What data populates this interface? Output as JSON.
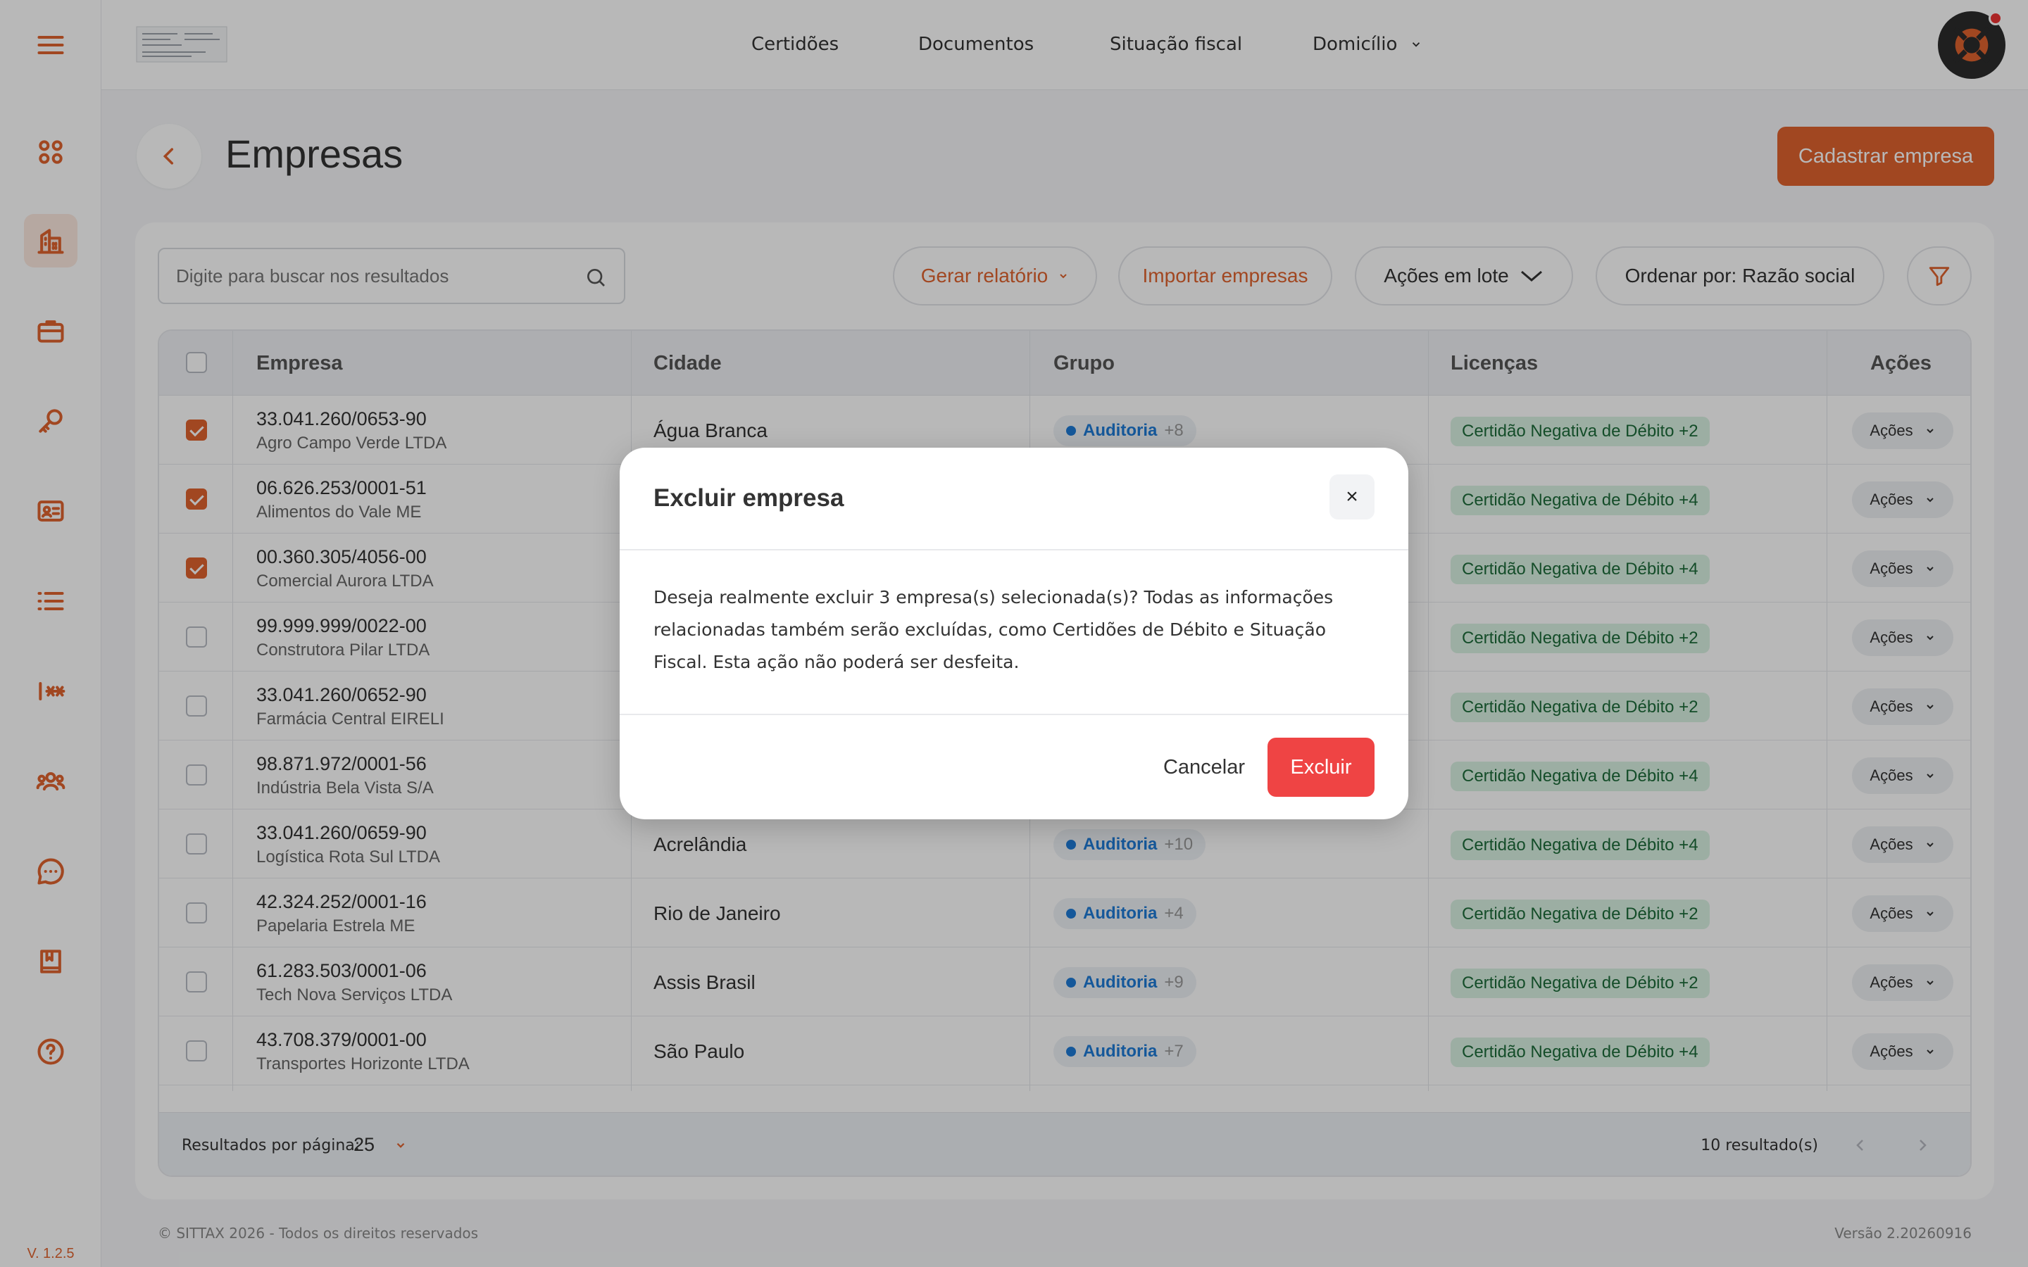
{
  "sidebar": {
    "version": "V. 1.2.5",
    "icons": [
      "menu-icon",
      "dashboard-icon",
      "buildings-icon",
      "briefcase-icon",
      "key-icon",
      "id-card-icon",
      "list-icon",
      "password-icon",
      "users-icon",
      "chat-icon",
      "book-icon",
      "help-icon"
    ]
  },
  "nav": {
    "items": [
      "Certidões",
      "Documentos",
      "Situação fiscal",
      "Domicílio"
    ]
  },
  "page": {
    "title": "Empresas",
    "primary_action": "Cadastrar empresa"
  },
  "toolbar": {
    "search_placeholder": "Digite para buscar nos resultados",
    "report": "Gerar relatório",
    "import": "Importar empresas",
    "bulk": "Ações em lote",
    "sort": "Ordenar por: Razão social"
  },
  "table": {
    "headers": [
      "Empresa",
      "Cidade",
      "Grupo",
      "Licenças",
      "Ações"
    ],
    "rows": [
      {
        "checked": true,
        "cnpj": "33.041.260/0653-90",
        "razao": "Agro Campo Verde LTDA",
        "cidade": "Água Branca",
        "grupo": "Auditoria",
        "grupo_more": "+8",
        "licenca": "Certidão Negativa de Débito +2",
        "acao": "Ações"
      },
      {
        "checked": true,
        "cnpj": "06.626.253/0001-51",
        "razao": "Alimentos do Vale ME",
        "cidade": "",
        "grupo": "",
        "grupo_more": "",
        "licenca": "Certidão Negativa de Débito +4",
        "acao": "Ações"
      },
      {
        "checked": true,
        "cnpj": "00.360.305/4056-00",
        "razao": "Comercial Aurora LTDA",
        "cidade": "",
        "grupo": "",
        "grupo_more": "",
        "licenca": "Certidão Negativa de Débito +4",
        "acao": "Ações"
      },
      {
        "checked": false,
        "cnpj": "99.999.999/0022-00",
        "razao": "Construtora Pilar LTDA",
        "cidade": "",
        "grupo": "",
        "grupo_more": "",
        "licenca": "Certidão Negativa de Débito +2",
        "acao": "Ações"
      },
      {
        "checked": false,
        "cnpj": "33.041.260/0652-90",
        "razao": "Farmácia Central EIRELI",
        "cidade": "",
        "grupo": "",
        "grupo_more": "",
        "licenca": "Certidão Negativa de Débito +2",
        "acao": "Ações"
      },
      {
        "checked": false,
        "cnpj": "98.871.972/0001-56",
        "razao": "Indústria Bela Vista S/A",
        "cidade": "",
        "grupo": "",
        "grupo_more": "",
        "licenca": "Certidão Negativa de Débito +4",
        "acao": "Ações"
      },
      {
        "checked": false,
        "cnpj": "33.041.260/0659-90",
        "razao": "Logística Rota Sul LTDA",
        "cidade": "Acrelândia",
        "grupo": "Auditoria",
        "grupo_more": "+10",
        "licenca": "Certidão Negativa de Débito +4",
        "acao": "Ações"
      },
      {
        "checked": false,
        "cnpj": "42.324.252/0001-16",
        "razao": "Papelaria Estrela ME",
        "cidade": "Rio de Janeiro",
        "grupo": "Auditoria",
        "grupo_more": "+4",
        "licenca": "Certidão Negativa de Débito +2",
        "acao": "Ações"
      },
      {
        "checked": false,
        "cnpj": "61.283.503/0001-06",
        "razao": "Tech Nova Serviços LTDA",
        "cidade": "Assis Brasil",
        "grupo": "Auditoria",
        "grupo_more": "+9",
        "licenca": "Certidão Negativa de Débito +2",
        "acao": "Ações"
      },
      {
        "checked": false,
        "cnpj": "43.708.379/0001-00",
        "razao": "Transportes Horizonte LTDA",
        "cidade": "São Paulo",
        "grupo": "Auditoria",
        "grupo_more": "+7",
        "licenca": "Certidão Negativa de Débito +4",
        "acao": "Ações"
      }
    ],
    "footer": {
      "per_page_label": "Resultados por página:",
      "per_page_value": "25",
      "count": "10 resultado(s)"
    }
  },
  "footer": {
    "copyright": "© SITTAX 2026 - Todos os direitos reservados",
    "version": "Versão 2.20260916"
  },
  "modal": {
    "title": "Excluir empresa",
    "close": "×",
    "body": "Deseja realmente excluir 3 empresa(s) selecionada(s)? Todas as informações relacionadas também serão excluídas, como Certidões de Débito e Situação Fiscal. Esta ação não poderá ser desfeita.",
    "cancel": "Cancelar",
    "confirm": "Excluir"
  },
  "colors": {
    "accent": "#e0632f",
    "danger": "#ef4444",
    "group_blue": "#1e7bd6",
    "license_bg": "#d9f1e2"
  }
}
